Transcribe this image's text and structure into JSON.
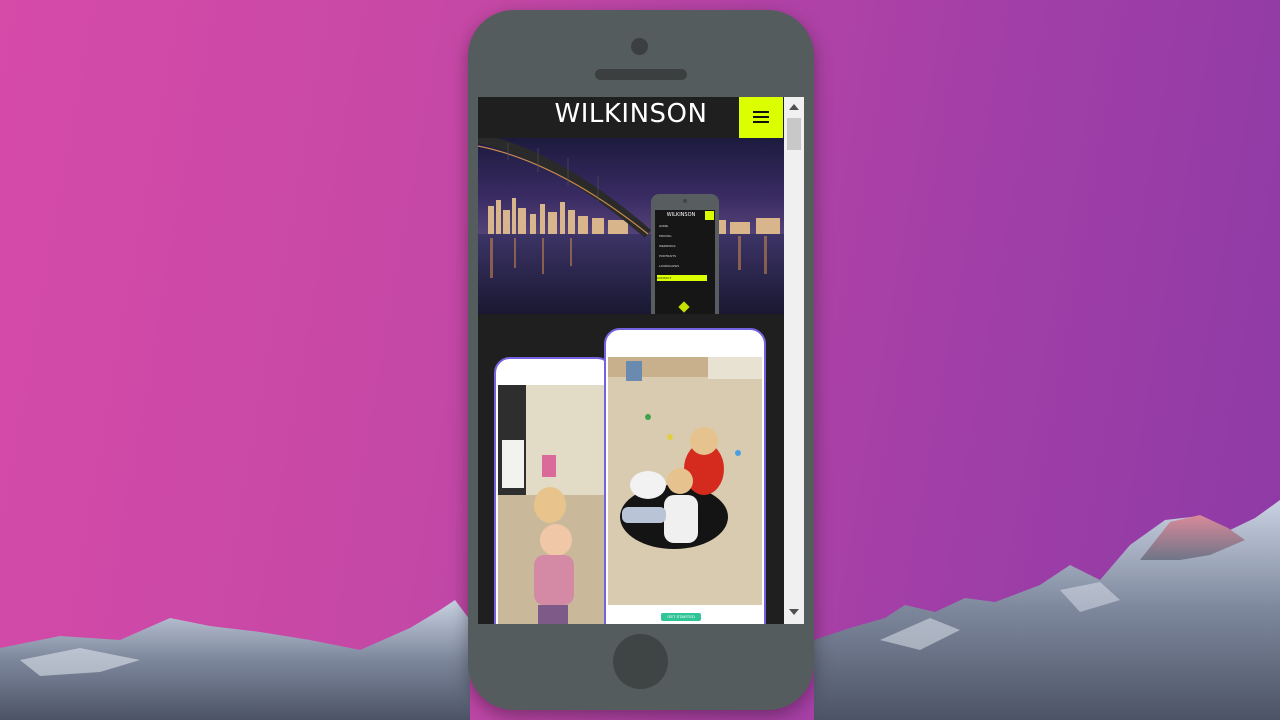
{
  "site": {
    "title": "WILKINSON",
    "menu_icon": "hamburger-menu-icon",
    "accent_color": "#dcff00",
    "header_bg": "#1f1f1f"
  },
  "mini_preview": {
    "title": "WILKINSON",
    "menu_items": [
      "HOME",
      "PRICING",
      "WEDDINGS",
      "PORTRAITS",
      "LANDSCAPES",
      "CONTACT"
    ],
    "active_index": 5
  },
  "mockups": {
    "cta_label": "GET STARTED",
    "cta_color": "#2fc597",
    "frame_color": "#7463e0"
  },
  "scrollbar": {
    "up_icon": "scroll-up-arrow-icon",
    "down_icon": "scroll-down-arrow-icon"
  }
}
